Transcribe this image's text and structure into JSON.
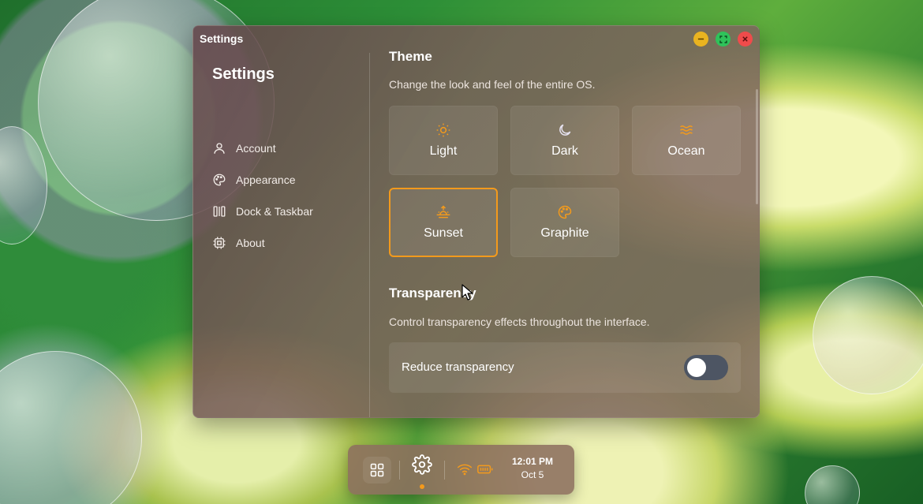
{
  "window": {
    "title": "Settings"
  },
  "sidebar": {
    "heading": "Settings",
    "items": [
      {
        "label": "Account",
        "icon": "user-icon"
      },
      {
        "label": "Appearance",
        "icon": "palette-icon"
      },
      {
        "label": "Dock & Taskbar",
        "icon": "dock-icon"
      },
      {
        "label": "About",
        "icon": "chip-icon"
      }
    ]
  },
  "theme": {
    "title": "Theme",
    "description": "Change the look and feel of the entire OS.",
    "options": [
      {
        "label": "Light",
        "icon": "sun-icon"
      },
      {
        "label": "Dark",
        "icon": "moon-icon"
      },
      {
        "label": "Ocean",
        "icon": "waves-icon"
      },
      {
        "label": "Sunset",
        "icon": "sunset-icon"
      },
      {
        "label": "Graphite",
        "icon": "palette-icon"
      }
    ],
    "selected": "Sunset"
  },
  "transparency": {
    "title": "Transparency",
    "description": "Control transparency effects throughout the interface.",
    "reduce_label": "Reduce transparency",
    "reduce_enabled": false
  },
  "dock": {
    "time": "12:01 PM",
    "date": "Oct 5"
  },
  "colors": {
    "accent": "#f39a1c",
    "close": "#ef4b4b",
    "minimize": "#e9b320",
    "maximize": "#2fc25a"
  }
}
